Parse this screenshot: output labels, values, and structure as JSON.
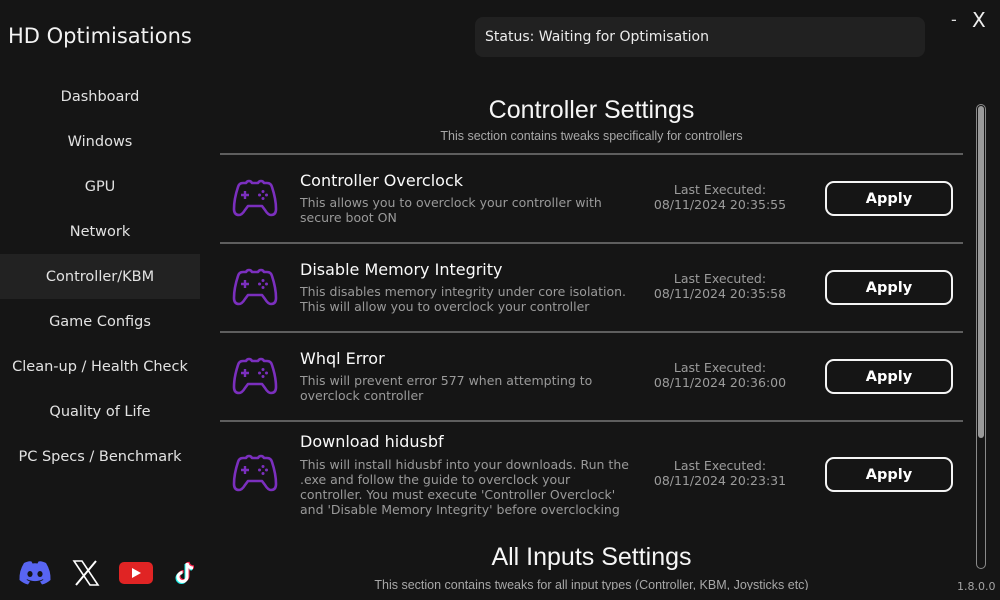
{
  "app": {
    "title": "HD Optimisations",
    "version": "1.8.0.0",
    "window_controls": {
      "minimize": "-",
      "close": "X"
    }
  },
  "status": {
    "text": "Status: Waiting for Optimisation"
  },
  "sidebar": {
    "items": [
      {
        "label": "Dashboard",
        "active": false
      },
      {
        "label": "Windows",
        "active": false
      },
      {
        "label": "GPU",
        "active": false
      },
      {
        "label": "Network",
        "active": false
      },
      {
        "label": "Controller/KBM",
        "active": true
      },
      {
        "label": "Game Configs",
        "active": false
      },
      {
        "label": "Clean-up / Health Check",
        "active": false
      },
      {
        "label": "Quality of Life",
        "active": false
      },
      {
        "label": "PC Specs / Benchmark",
        "active": false
      }
    ],
    "socials": [
      {
        "name": "discord-icon",
        "color": "#5865F2"
      },
      {
        "name": "x-icon",
        "color": "#ffffff"
      },
      {
        "name": "youtube-icon",
        "color": "#E02424"
      },
      {
        "name": "tiktok-icon",
        "color": "#ffffff"
      }
    ]
  },
  "sections": [
    {
      "title": "Controller Settings",
      "subtitle": "This section contains tweaks specifically for controllers",
      "tweaks": [
        {
          "icon": "gamepad-icon",
          "title": "Controller Overclock",
          "description": "This allows you to overclock your controller with secure boot ON",
          "last_executed_label": "Last Executed:",
          "last_executed": "08/11/2024 20:35:55",
          "button": "Apply"
        },
        {
          "icon": "gamepad-icon",
          "title": "Disable Memory Integrity",
          "description": "This disables memory integrity under core isolation. This will allow you to overclock your controller",
          "last_executed_label": "Last Executed:",
          "last_executed": "08/11/2024 20:35:58",
          "button": "Apply"
        },
        {
          "icon": "gamepad-icon",
          "title": "Whql Error",
          "description": "This will prevent error 577 when attempting to overclock controller",
          "last_executed_label": "Last Executed:",
          "last_executed": "08/11/2024 20:36:00",
          "button": "Apply"
        },
        {
          "icon": "gamepad-icon",
          "title": "Download hidusbf",
          "description": "This will install hidusbf into your downloads. Run the .exe and follow the guide to overclock your controller. You must execute 'Controller Overclock' and 'Disable Memory Integrity' before overclocking",
          "last_executed_label": "Last Executed:",
          "last_executed": "08/11/2024 20:23:31",
          "button": "Apply"
        }
      ]
    },
    {
      "title": "All Inputs Settings",
      "subtitle": "This section contains tweaks for all input types (Controller, KBM, Joysticks etc)"
    }
  ],
  "scroll": {
    "visible_fraction": 0.72,
    "position": 0.0
  },
  "colors": {
    "accent": "#7B2FBE",
    "background": "#151515",
    "panel": "#212121"
  }
}
